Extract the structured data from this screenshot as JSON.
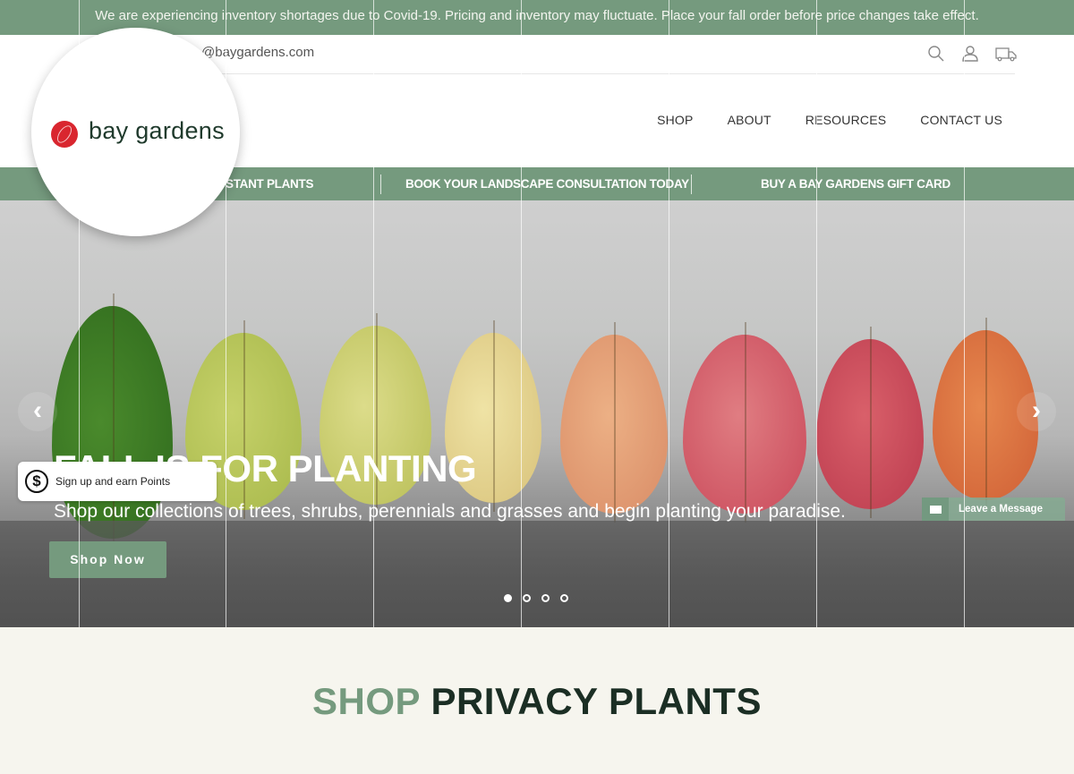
{
  "announcement": "We are experiencing inventory shortages due to Covid-19. Pricing and inventory may fluctuate. Place your fall order before price changes take effect.",
  "header": {
    "email_visible": "@baygardens.com",
    "icons": [
      "search-icon",
      "account-icon",
      "delivery-truck-icon"
    ],
    "brand_name": "bay gardens",
    "nav": [
      "SHOP",
      "ABOUT",
      "RESOURCES",
      "CONTACT US"
    ]
  },
  "promo_bar": {
    "items": [
      "STANT PLANTS",
      "BOOK YOUR LANDSCAPE CONSULTATION TODAY",
      "BUY A BAY GARDENS GIFT CARD"
    ]
  },
  "hero": {
    "title": "FALL IS FOR PLANTING",
    "subtitle": "Shop our collections of trees, shrubs, perennials and grasses and begin planting your paradise.",
    "cta": "Shop Now",
    "prev_icon": "‹",
    "next_icon": "›",
    "slides_total": 4,
    "active_slide": 1
  },
  "rewards_widget": {
    "icon": "$",
    "label": "Sign up and earn Points"
  },
  "chat_widget": {
    "label": "Leave a Message"
  },
  "section": {
    "accent": "SHOP",
    "title": " PRIVACY PLANTS"
  },
  "colors": {
    "brand_green": "#759a7e",
    "logo_red": "#d9262f",
    "dark_text": "#1b2e24",
    "bg": "#f6f5ee"
  }
}
